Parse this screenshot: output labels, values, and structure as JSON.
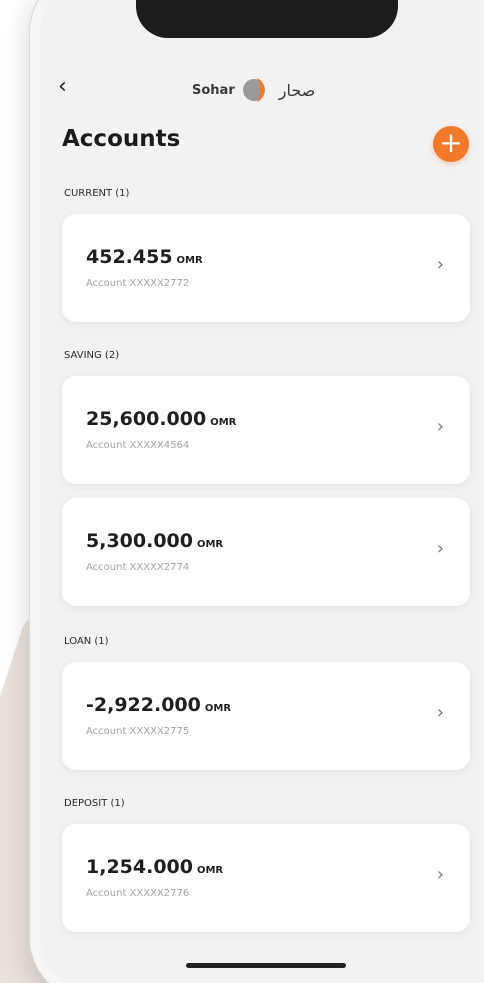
{
  "nav": {
    "back_glyph": "‹",
    "logo_en": "Sohar",
    "logo_ar": "صحار"
  },
  "header": {
    "title": "Accounts",
    "add_glyph": "+"
  },
  "sections": {
    "current": "CURRENT (1)",
    "saving": "SAVING (2)",
    "loan": "LOAN (1)",
    "deposit": "DEPOSIT (1)"
  },
  "accounts": [
    {
      "amount": "452.455",
      "currency": "OMR",
      "number": "Account XXXXX2772"
    },
    {
      "amount": "25,600.000",
      "currency": "OMR",
      "number": "Account XXXXX4564"
    },
    {
      "amount": "5,300.000",
      "currency": "OMR",
      "number": "Account XXXXX2774"
    },
    {
      "amount": "-2,922.000",
      "currency": "OMR",
      "number": "Account XXXXX2775"
    },
    {
      "amount": "1,254.000",
      "currency": "OMR",
      "number": "Account XXXXX2776"
    }
  ],
  "chevron_glyph": "›",
  "colors": {
    "accent": "#f07a2a",
    "background": "#f2f2f2",
    "card": "#ffffff"
  }
}
